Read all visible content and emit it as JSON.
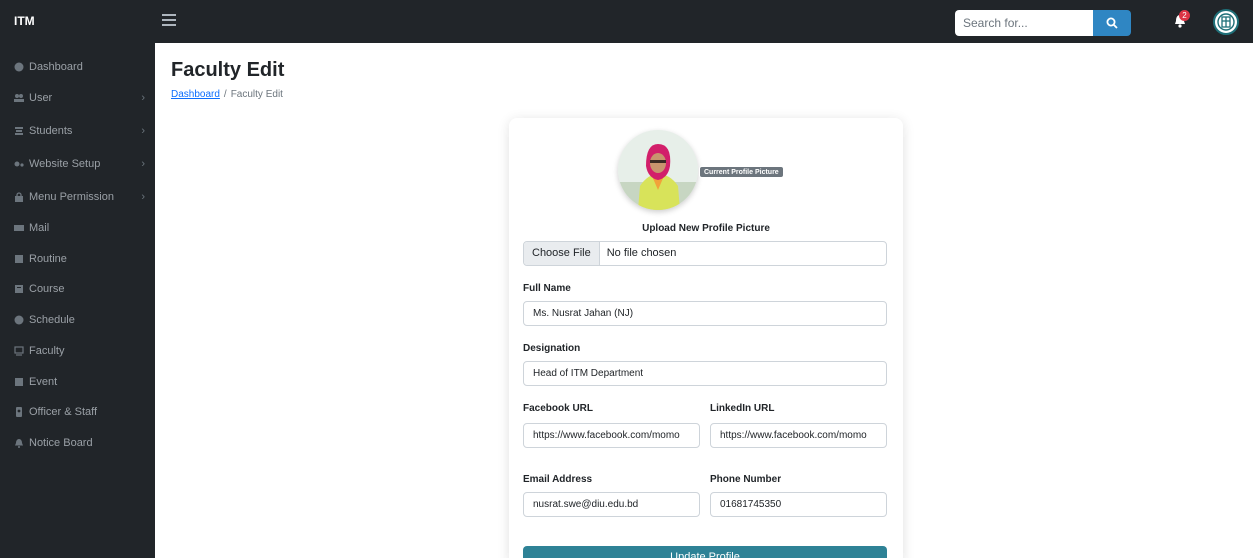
{
  "brand": "ITM",
  "search": {
    "placeholder": "Search for..."
  },
  "notifications": {
    "count": "2"
  },
  "sidebar": {
    "items": [
      {
        "label": "Dashboard",
        "icon": "dashboard-icon",
        "has_submenu": false
      },
      {
        "label": "User",
        "icon": "users-icon",
        "has_submenu": true
      },
      {
        "label": "Students",
        "icon": "students-icon",
        "has_submenu": true
      },
      {
        "label": "Website Setup",
        "icon": "setup-icon",
        "has_submenu": true
      },
      {
        "label": "Menu Permission",
        "icon": "lock-icon",
        "has_submenu": true
      },
      {
        "label": "Mail",
        "icon": "mail-icon",
        "has_submenu": false
      },
      {
        "label": "Routine",
        "icon": "calendar-icon",
        "has_submenu": false
      },
      {
        "label": "Course",
        "icon": "book-icon",
        "has_submenu": false
      },
      {
        "label": "Schedule",
        "icon": "clock-icon",
        "has_submenu": false
      },
      {
        "label": "Faculty",
        "icon": "chalkboard-icon",
        "has_submenu": false
      },
      {
        "label": "Event",
        "icon": "event-icon",
        "has_submenu": false
      },
      {
        "label": "Officer & Staff",
        "icon": "id-badge-icon",
        "has_submenu": false
      },
      {
        "label": "Notice Board",
        "icon": "bell-icon",
        "has_submenu": false
      }
    ]
  },
  "page": {
    "title": "Faculty Edit",
    "breadcrumb": {
      "home": "Dashboard",
      "sep": "/",
      "current": "Faculty Edit"
    }
  },
  "form": {
    "current_picture_badge": "Current Profile Picture",
    "upload_label": "Upload New Profile Picture",
    "file_button": "Choose File",
    "file_status": "No file chosen",
    "full_name": {
      "label": "Full Name",
      "value": "Ms. Nusrat Jahan (NJ)"
    },
    "designation": {
      "label": "Designation",
      "value": "Head of ITM Department"
    },
    "facebook": {
      "label": "Facebook URL",
      "value": "https://www.facebook.com/momo"
    },
    "linkedin": {
      "label": "LinkedIn URL",
      "value": "https://www.facebook.com/momo"
    },
    "email": {
      "label": "Email Address",
      "value": "nusrat.swe@diu.edu.bd"
    },
    "phone": {
      "label": "Phone Number",
      "value": "01681745350"
    },
    "submit": "Update Profile"
  },
  "colors": {
    "topbar": "#212529",
    "accent": "#2e8296",
    "search_button": "#2f86c3",
    "badge": "#dc3545"
  }
}
